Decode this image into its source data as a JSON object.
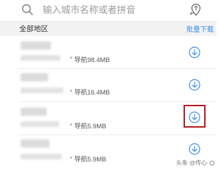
{
  "search": {
    "placeholder": "输入城市名称或者拼音",
    "search_icon": "search-icon",
    "location_icon": "location-question-icon"
  },
  "section": {
    "title": "全部地区",
    "batch_download_label": "批量下载"
  },
  "items": [
    {
      "size_label": "导航98.4MB",
      "action_icon": "download-circle-icon"
    },
    {
      "size_label": "导航16.4MB",
      "action_icon": "download-circle-icon"
    },
    {
      "size_label": "导航5.9MB",
      "action_icon": "download-circle-icon",
      "highlighted": true
    },
    {
      "size_label": "导航5.9MB",
      "action_icon": "download-circle-icon"
    }
  ],
  "watermark": {
    "text": "头条 @传心·"
  },
  "colors": {
    "accent": "#3a8ee6",
    "highlight": "#b3121a",
    "section_bg": "#f2f2f2"
  }
}
